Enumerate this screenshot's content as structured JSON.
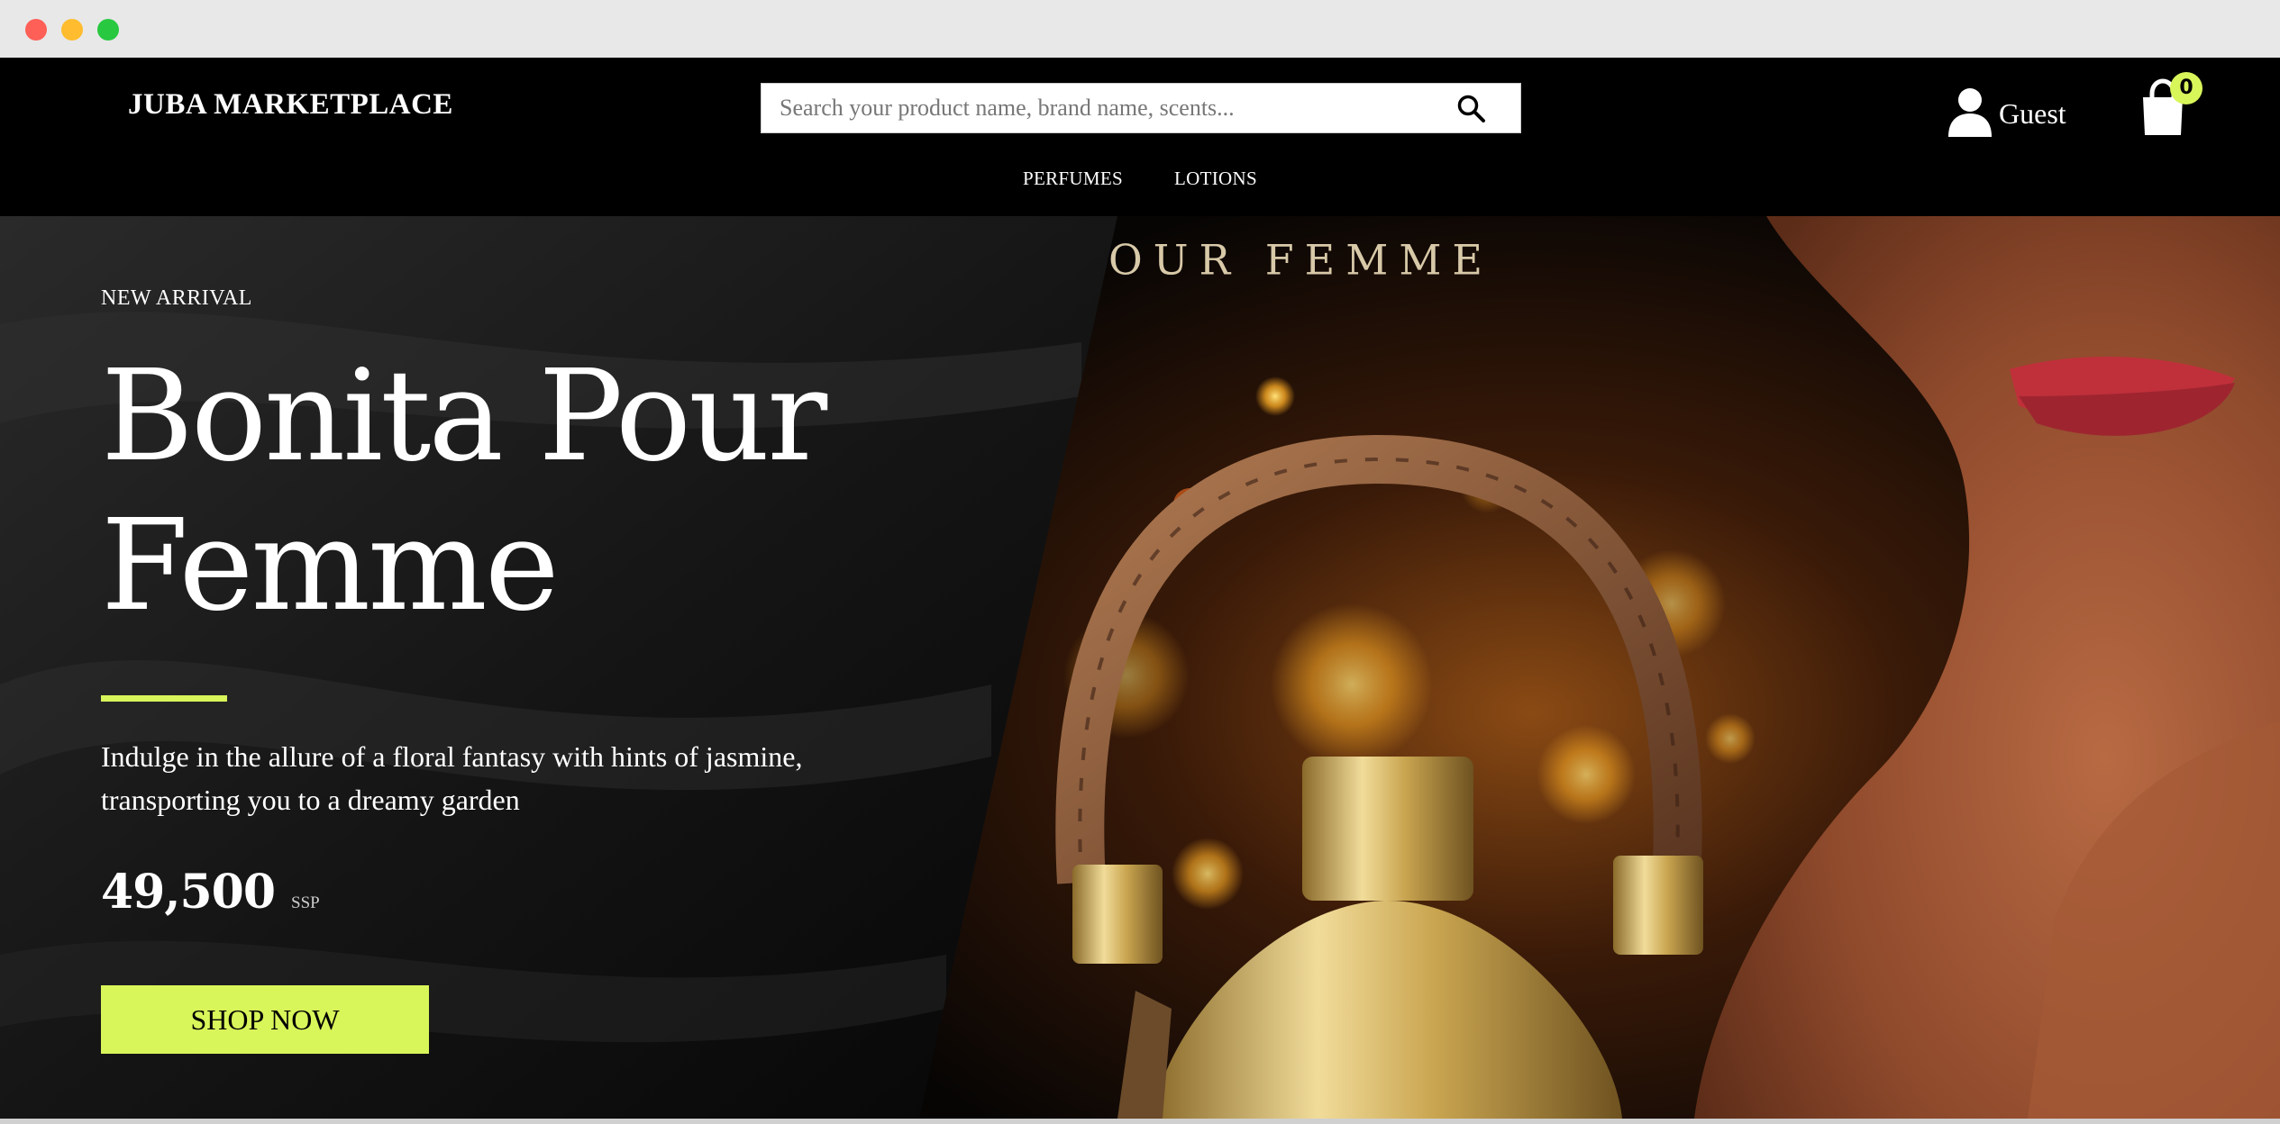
{
  "header": {
    "brand": "JUBA MARKETPLACE",
    "search_placeholder": "Search your product name, brand name, scents...",
    "user_label": "Guest",
    "cart_count": "0"
  },
  "nav": {
    "items": [
      {
        "label": "PERFUMES"
      },
      {
        "label": "LOTIONS"
      }
    ]
  },
  "hero": {
    "eyebrow": "NEW ARRIVAL",
    "title": "Bonita Pour Femme",
    "poster_text": "OUR FEMME",
    "description": "Indulge in the allure of a floral fantasy with hints of jasmine, transporting you to a dreamy garden",
    "price": "49,500",
    "currency": "SSP",
    "cta_label": "SHOP NOW"
  },
  "colors": {
    "accent": "#d8f55a",
    "background": "#000000"
  },
  "icons": [
    "search-icon",
    "user-icon",
    "shopping-bag-icon"
  ]
}
